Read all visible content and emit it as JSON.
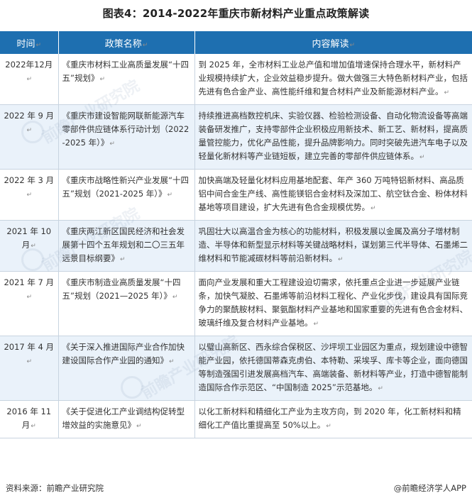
{
  "title": "图表4：2014-2022年重庆市新材料产业重点政策解读",
  "headers": {
    "time": "时间",
    "policy": "政策名称",
    "content": "内容解读"
  },
  "return_mark": "↵",
  "rows": [
    {
      "time": "2022年12月",
      "policy": "《重庆市材料工业高质量发展“十四五”规划》",
      "content": "到 2025 年，全市材料工业总产值和增加值增速保持合理水平，新材料产业规模持续扩大，企业效益稳步提升。做大做强三大特色新材料产业，包括先进有色合金产业、高性能纤维和复合材料产业及新能源材料产业。"
    },
    {
      "time": "2022 年 9 月",
      "policy": "《重庆市建设智能网联新能源汽车零部件供应链体系行动计划（2022-2025 年）》",
      "content": "持续推进高档数控机床、实验仪器、检验检测设备、自动化物流设备等高端装备研发推广，支持零部件企业积极应用新技术、新工艺、新材料，提高质量管控能力，优化产品性能，提升品牌影响力。同时突破先进汽车电子以及轻量化新材料等产业链短板，建立完善的零部件供应链体系。"
    },
    {
      "time": "2022 年 3 月",
      "policy": "《重庆市战略性新兴产业发展“十四五”规划（2021-2025 年）》",
      "content": "加快高端及轻量化材料应用基地配套、年产 360 万吨特铝新材料、高品质铝中间合金生产线、高性能镁铝合金材料及深加工、航空钛合金、粉体材料基地等项目建设，扩大先进有色合金规模优势。"
    },
    {
      "time": "2021 年 10 月",
      "policy": "《重庆两江新区国民经济和社会发展第十四个五年规划和二〇三五年远景目标纲要》",
      "content": "巩固壮大以高温合金为核心的功能材料，积极发展以金属及高分子增材制造、半导体和新型显示材料等关键战略材料，谋划第三代半导体、石墨烯二维材料和节能减碳材料等前沿新材料。"
    },
    {
      "time": "2021 年 7 月",
      "policy": "《重庆市制造业高质量发展“十四五”规划（2021—2025 年）》",
      "content": "面向产业发展和重大工程建设迫切需求，依托重点企业进一步延展产业链条，加快气凝胶、石墨烯等前沿材料工程化、产业化步伐，建设具有国际竞争力的聚酰胺材料、聚氨酯材料产业基地和国家重要的先进有色合金材料、玻璃纤维及复合材料产业基地。"
    },
    {
      "time": "2017 年 4 月",
      "policy": "《关于深入推进国际产业合作加快建设国际合作产业园的通知》",
      "content": "以璧山高新区、西永综合保税区、沙坪坝工业园区为重点，规划建设中德智能产业园，依托德国蒂森克虏伯、本特勒、采埃孚、库卡等企业，面向德国等制造强国引进发展高档汽车、高端装备、新材料等产业，打造中德智能制造国际合作示范区、“中国制造 2025”示范基地。"
    },
    {
      "time": "2016 年 11 月",
      "policy": "《关于促进化工产业调结构促转型增效益的实施意见》",
      "content": "以化工新材料和精细化工产业为主攻方向，到 2020 年，化工新材料和精细化工产值比重提高至 50%以上。"
    }
  ],
  "footer": {
    "source": "资料来源：前瞻产业研究院",
    "brand": "@前瞻经济学人APP"
  },
  "watermark": "前瞻产业研究院"
}
